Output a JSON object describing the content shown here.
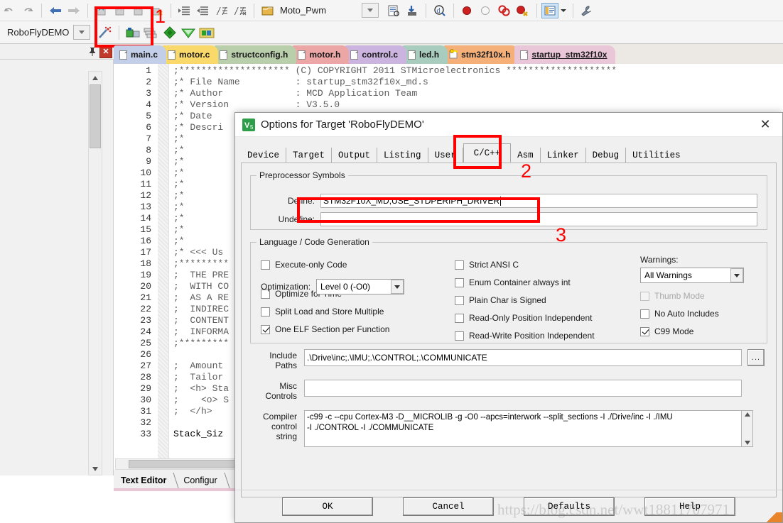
{
  "app": {
    "project_name": "Moto_Pwm",
    "target_name": "RoboFlyDEMO"
  },
  "toolbar": {
    "icons_row1": [
      "undo-icon",
      "redo-icon",
      "back-arrow-icon",
      "forward-arrow-icon",
      "bookmark-toggle-icon",
      "bookmark-prev-icon",
      "bookmark-next-icon",
      "bookmark-clear-icon",
      "indent-icon",
      "outdent-icon",
      "comment-icon",
      "uncomment-icon",
      "open-folder-icon"
    ],
    "icons_row1b": [
      "dropdown-icon",
      "build-log-icon",
      "download-icon",
      "find-in-files-icon",
      "breakpoint-icon",
      "breakpoint-disabled-icon",
      "breakpoint-toggle-icon",
      "breakpoint-kill-icon",
      "project-window-icon",
      "configure-icon"
    ],
    "icons_row2": [
      "target-dropdown-icon",
      "magic-wand-icon",
      "build-target-icon",
      "rebuild-all-icon",
      "batch-build-icon",
      "translate-icon",
      "manage-project-icon"
    ],
    "project_label": "Moto_Pwm"
  },
  "project_panel": {
    "title": "RoboFlyDEMO",
    "pin_icon": "pin-icon",
    "close_icon": "close-icon"
  },
  "editor_tabs": [
    {
      "label": "main.c",
      "icon": "document-icon",
      "color": "#c3cfe8",
      "active": false
    },
    {
      "label": "motor.c",
      "icon": "document-icon",
      "color": "#fad96b",
      "active": false
    },
    {
      "label": "structconfig.h",
      "icon": "document-icon",
      "color": "#b9ceaa",
      "active": false
    },
    {
      "label": "motor.h",
      "icon": "document-icon",
      "color": "#eda6a6",
      "active": false
    },
    {
      "label": "control.c",
      "icon": "document-icon",
      "color": "#cbb4e0",
      "active": false
    },
    {
      "label": "led.h",
      "icon": "document-icon",
      "color": "#a8ccbe",
      "active": false
    },
    {
      "label": "stm32f10x.h",
      "icon": "key-icon",
      "color": "#f5b07a",
      "active": false
    },
    {
      "label": "startup_stm32f10x",
      "icon": "document-icon",
      "color": "#e9c7d8",
      "active": true
    }
  ],
  "code": {
    "line_numbers": [
      "1",
      "2",
      "3",
      "4",
      "5",
      "6",
      "7",
      "8",
      "9",
      "10",
      "11",
      "12",
      "13",
      "14",
      "15",
      "16",
      "17",
      "18",
      "19",
      "20",
      "21",
      "22",
      "23",
      "24",
      "25",
      "26",
      "27",
      "28",
      "29",
      "30",
      "31",
      "32",
      "33"
    ],
    "lines": [
      ";******************** (C) COPYRIGHT 2011 STMicroelectronics ********************",
      ";* File Name          : startup_stm32f10x_md.s",
      ";* Author             : MCD Application Team",
      ";* Version            : V3.5.0",
      ";* Date               :",
      ";* Descri",
      ";*",
      ";*",
      ";*",
      ";*",
      ";*",
      ";*",
      ";*",
      ";*",
      ";*",
      ";*",
      ";* <<< Us",
      ";*********",
      ";  THE PRE",
      ";  WITH CO",
      ";  AS A RE",
      ";  INDIREC",
      ";  CONTENT",
      ";  INFORMA",
      ";*********",
      "",
      ";  Amount",
      ";  Tailor",
      ";  <h> Sta",
      ";    <o> S",
      ";  </h>",
      "",
      "Stack_Siz"
    ],
    "code_line_index": 32
  },
  "bottom_tabs": [
    {
      "label": "Text Editor",
      "active": true
    },
    {
      "label": "Configur",
      "active": false
    }
  ],
  "dialog": {
    "title": "Options for Target 'RoboFlyDEMO'",
    "title_icon": "keil-uvision-icon",
    "close_icon": "close-icon",
    "tabs": [
      {
        "label": "Device",
        "selected": false
      },
      {
        "label": "Target",
        "selected": false
      },
      {
        "label": "Output",
        "selected": false
      },
      {
        "label": "Listing",
        "selected": false
      },
      {
        "label": "User",
        "selected": false
      },
      {
        "label": "C/C++",
        "selected": true
      },
      {
        "label": "Asm",
        "selected": false
      },
      {
        "label": "Linker",
        "selected": false
      },
      {
        "label": "Debug",
        "selected": false
      },
      {
        "label": "Utilities",
        "selected": false
      }
    ],
    "preprocessor": {
      "group_label": "Preprocessor Symbols",
      "define_label": "Define:",
      "define_value": "STM32F10X_MD,USE_STDPERIPH_DRIVER",
      "undefine_label": "Undefine:",
      "undefine_value": ""
    },
    "language": {
      "group_label": "Language / Code Generation",
      "left_checks": [
        {
          "label": "Execute-only Code",
          "checked": false,
          "disabled": false
        },
        {
          "label": "Optimize for Time",
          "checked": false,
          "disabled": false
        },
        {
          "label": "Split Load and Store Multiple",
          "checked": false,
          "disabled": false
        },
        {
          "label": "One ELF Section per Function",
          "checked": true,
          "disabled": false
        }
      ],
      "optimization_label": "Optimization:",
      "optimization_value": "Level 0 (-O0)",
      "mid_checks": [
        {
          "label": "Strict ANSI C",
          "checked": false,
          "disabled": false
        },
        {
          "label": "Enum Container always int",
          "checked": false,
          "disabled": false
        },
        {
          "label": "Plain Char is Signed",
          "checked": false,
          "disabled": false
        },
        {
          "label": "Read-Only Position Independent",
          "checked": false,
          "disabled": false
        },
        {
          "label": "Read-Write Position Independent",
          "checked": false,
          "disabled": false
        }
      ],
      "warnings_label": "Warnings:",
      "warnings_value": "All Warnings",
      "right_checks": [
        {
          "label": "Thumb Mode",
          "checked": false,
          "disabled": true
        },
        {
          "label": "No Auto Includes",
          "checked": false,
          "disabled": false
        },
        {
          "label": "C99 Mode",
          "checked": true,
          "disabled": false
        }
      ]
    },
    "paths": {
      "include_label_l1": "Include",
      "include_label_l2": "Paths",
      "include_value": ".\\Drive\\inc;.\\IMU;.\\CONTROL;.\\COMMUNICATE",
      "browse_label": "...",
      "misc_label_l1": "Misc",
      "misc_label_l2": "Controls",
      "misc_value": "",
      "compiler_label_l1": "Compiler",
      "compiler_label_l2": "control",
      "compiler_label_l3": "string",
      "compiler_value_line1": "-c99 -c --cpu Cortex-M3 -D__MICROLIB -g -O0 --apcs=interwork --split_sections -I ./Drive/inc -I ./IMU",
      "compiler_value_line2": "-I ./CONTROL -I ./COMMUNICATE"
    },
    "buttons": [
      {
        "label": "OK"
      },
      {
        "label": "Cancel"
      },
      {
        "label": "Defaults"
      },
      {
        "label": "Help"
      }
    ]
  },
  "annotations": {
    "markers": [
      "1",
      "2",
      "3"
    ],
    "color": "#fe0000"
  },
  "watermark": {
    "text": "https://blog.csdn.net/wwt18811707971"
  }
}
